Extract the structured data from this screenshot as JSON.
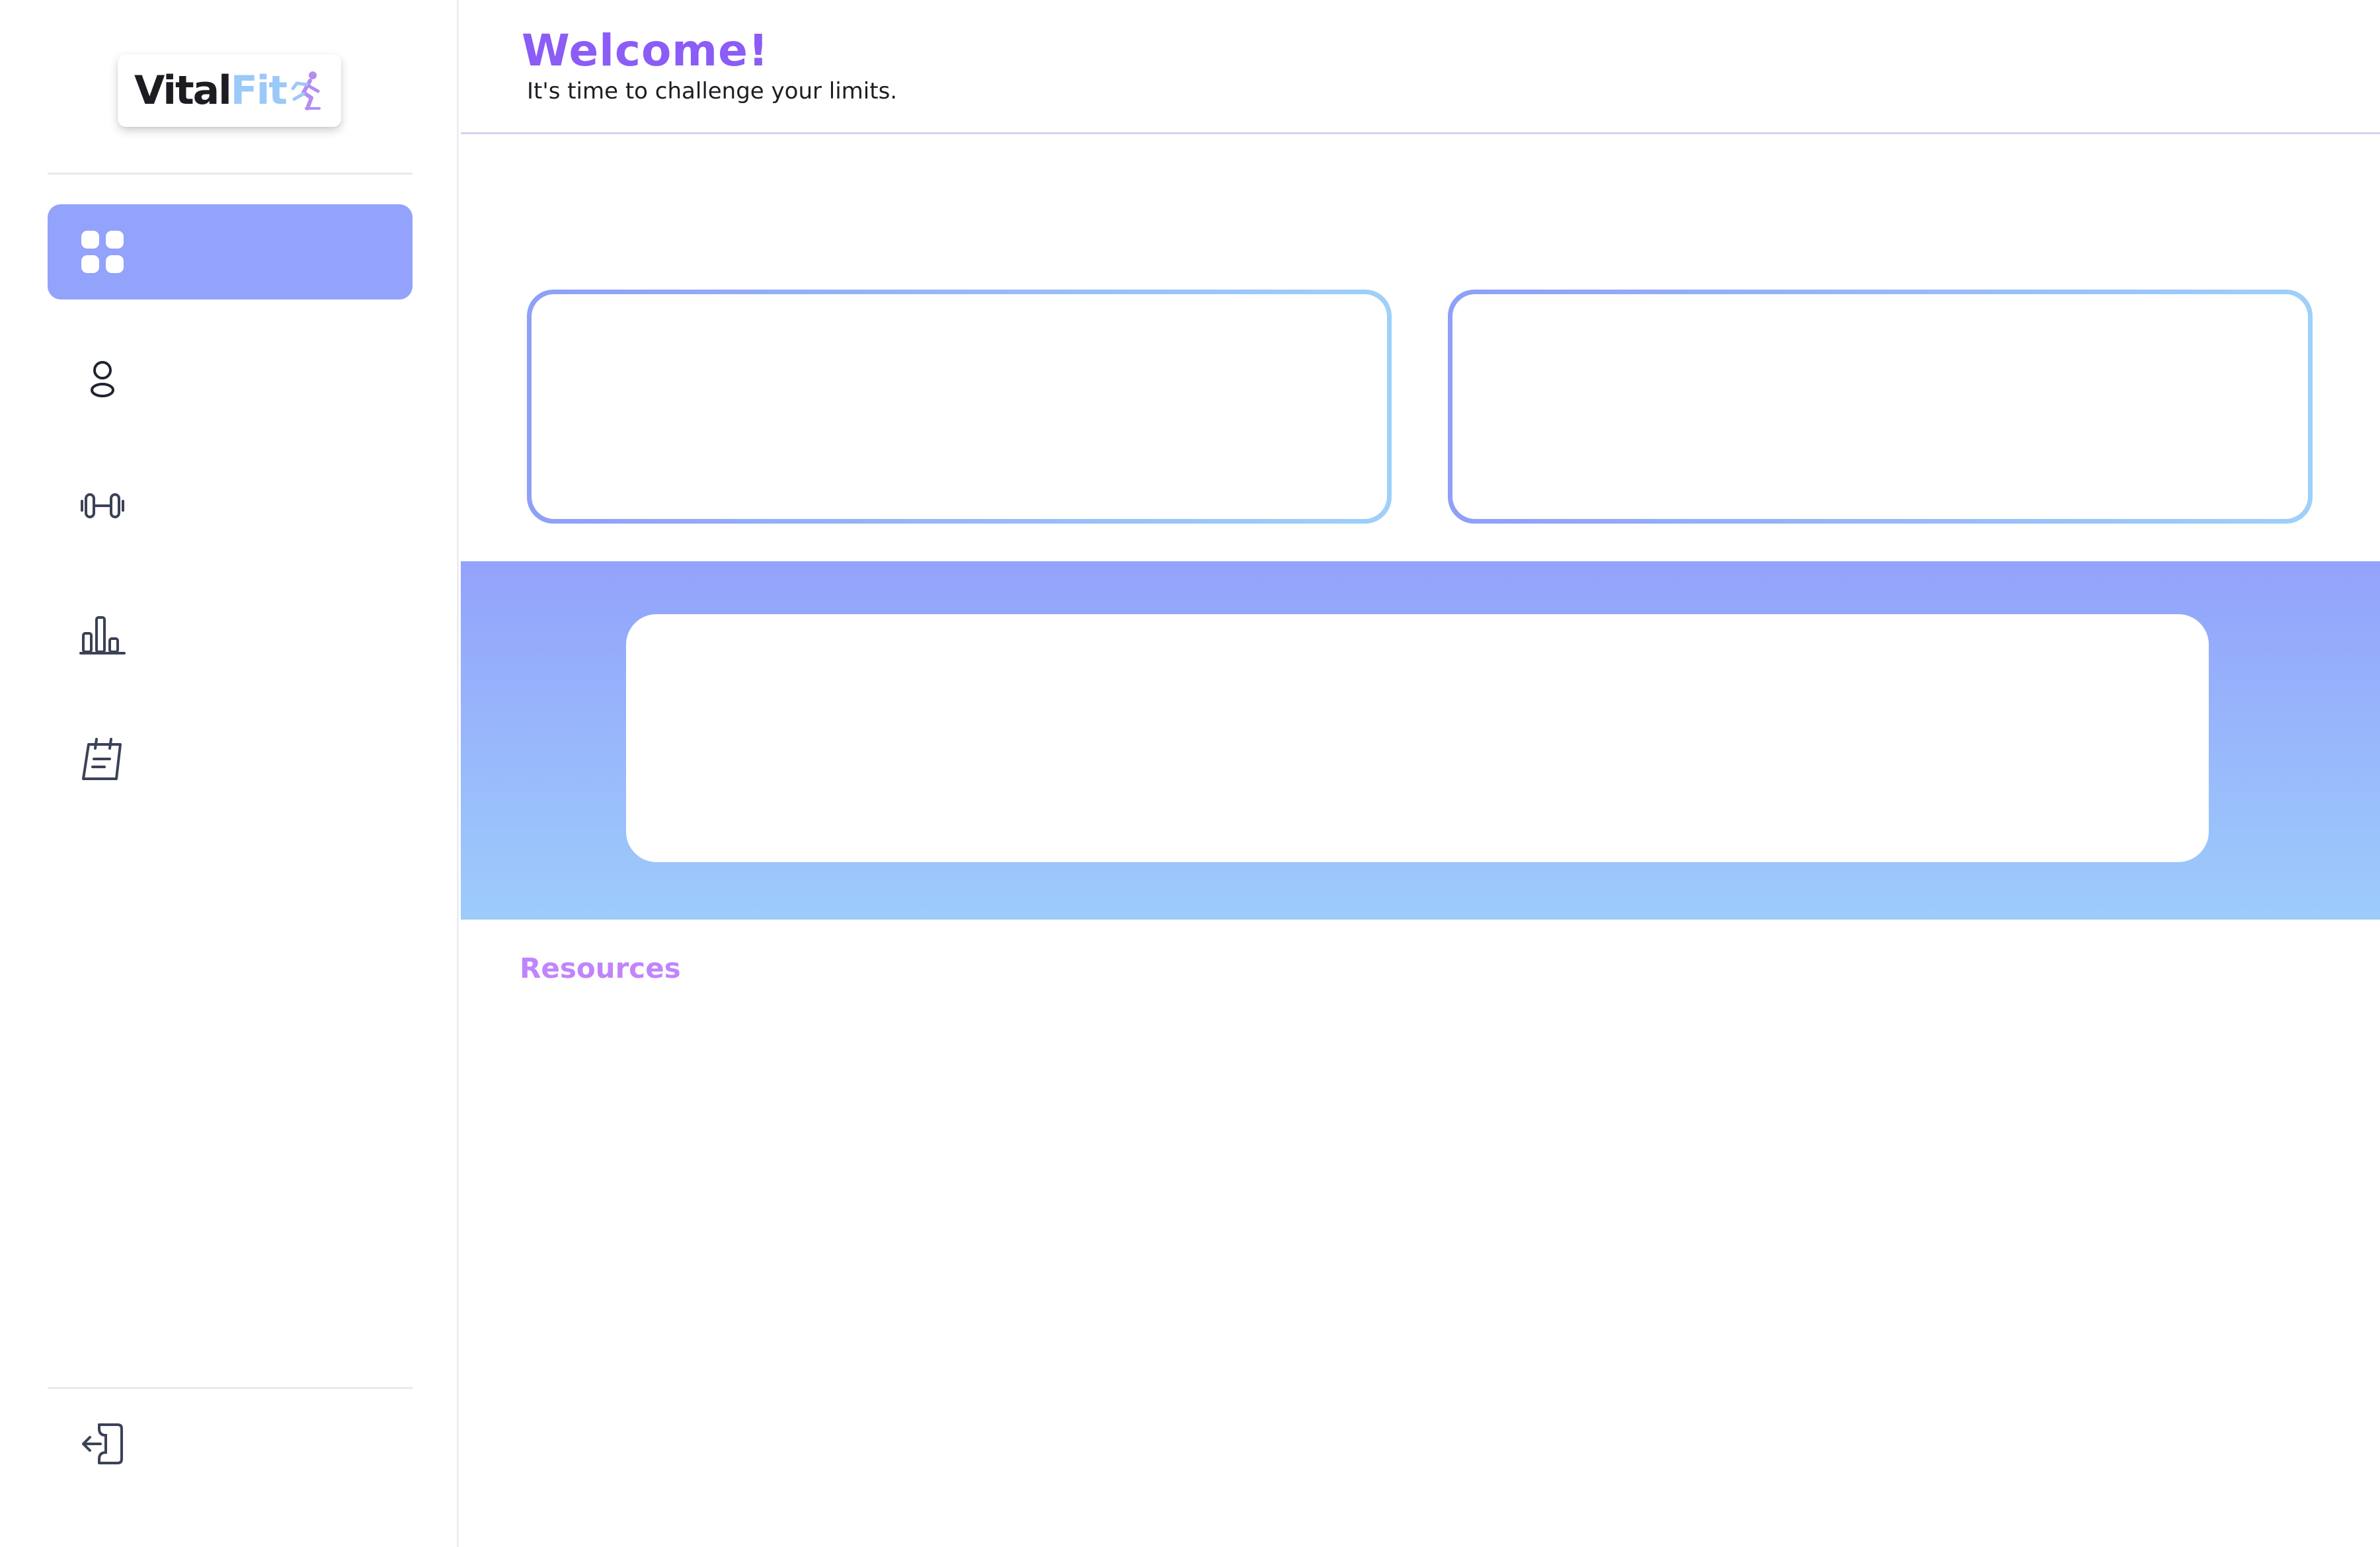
{
  "brand": {
    "name_part1": "Vital",
    "name_part2": "Fit",
    "colors": {
      "dark": "#1c1c22",
      "light_blue": "#9bc9f8",
      "purple": "#b48cf2"
    }
  },
  "sidebar": {
    "items": [
      {
        "icon": "dashboard-grid-icon",
        "active": true
      },
      {
        "icon": "user-profile-icon",
        "active": false
      },
      {
        "icon": "dumbbell-icon",
        "active": false
      },
      {
        "icon": "bar-chart-icon",
        "active": false
      },
      {
        "icon": "calendar-notes-icon",
        "active": false
      }
    ],
    "logout_icon": "logout-icon",
    "active_color": "#93a2fb"
  },
  "header": {
    "title": "Welcome!",
    "subtitle": "It's time to challenge your limits.",
    "title_color": "#8b5cf6"
  },
  "main": {
    "resources_label": "Resources",
    "resources_color": "#c084fc",
    "card_gradient": [
      "#8ea0f7",
      "#9fd0fa"
    ],
    "banner_gradient": [
      "#93a2fb",
      "#9dccfb"
    ]
  }
}
